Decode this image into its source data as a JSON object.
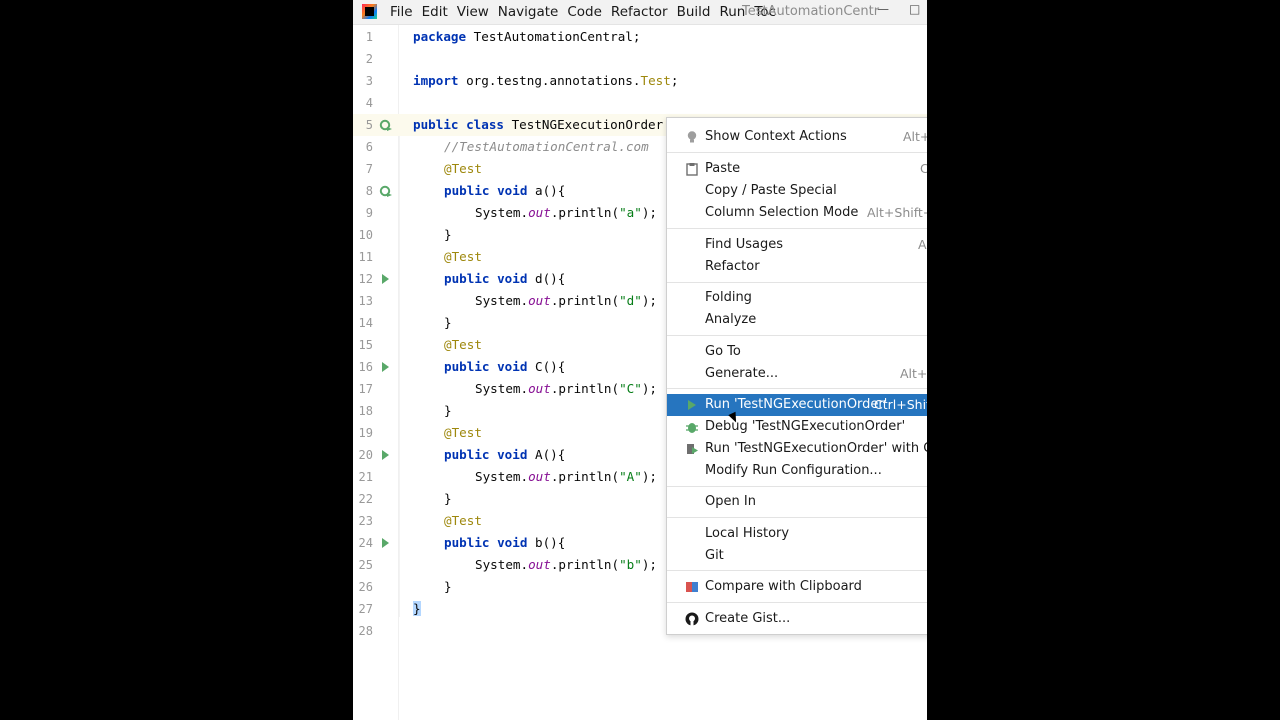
{
  "window": {
    "title": "TestAutomationCentr"
  },
  "menu": [
    "File",
    "Edit",
    "View",
    "Navigate",
    "Code",
    "Refactor",
    "Build",
    "Run",
    "Toc"
  ],
  "code_lines": [
    {
      "n": "1"
    },
    {
      "n": "2"
    },
    {
      "n": "3"
    },
    {
      "n": "4"
    },
    {
      "n": "5"
    },
    {
      "n": "6"
    },
    {
      "n": "7"
    },
    {
      "n": "8"
    },
    {
      "n": "9"
    },
    {
      "n": "10"
    },
    {
      "n": "11"
    },
    {
      "n": "12"
    },
    {
      "n": "13"
    },
    {
      "n": "14"
    },
    {
      "n": "15"
    },
    {
      "n": "16"
    },
    {
      "n": "17"
    },
    {
      "n": "18"
    },
    {
      "n": "19"
    },
    {
      "n": "20"
    },
    {
      "n": "21"
    },
    {
      "n": "22"
    },
    {
      "n": "23"
    },
    {
      "n": "24"
    },
    {
      "n": "25"
    },
    {
      "n": "26"
    },
    {
      "n": "27"
    },
    {
      "n": "28"
    }
  ],
  "code": {
    "l1": {
      "kw": "package",
      "rest": " TestAutomationCentral;"
    },
    "l3": {
      "kw": "import",
      "pre": " org.testng.annotations.",
      "ann": "Test",
      "post": ";"
    },
    "l5": {
      "kw": "public class",
      "rest": " TestNGExecutionOrder"
    },
    "l6": {
      "cmt": "//TestAutomationCentral.com"
    },
    "annotation": "@Test",
    "method_kw": "public void",
    "methods": [
      {
        "sig": " a(){",
        "body_pre": "System.",
        "field": "out",
        "body_mid": ".println(",
        "str": "\"a\"",
        "body_post": ");"
      },
      {
        "sig": " d(){",
        "body_pre": "System.",
        "field": "out",
        "body_mid": ".println(",
        "str": "\"d\"",
        "body_post": ");"
      },
      {
        "sig": " C(){",
        "body_pre": "System.",
        "field": "out",
        "body_mid": ".println(",
        "str": "\"C\"",
        "body_post": ");"
      },
      {
        "sig": " A(){",
        "body_pre": "System.",
        "field": "out",
        "body_mid": ".println(",
        "str": "\"A\"",
        "body_post": ");"
      },
      {
        "sig": " b(){",
        "body_pre": "System.",
        "field": "out",
        "body_mid": ".println(",
        "str": "\"b\"",
        "body_post": ");"
      }
    ],
    "close_brace": "}",
    "class_close": "}"
  },
  "context_menu": {
    "items": [
      {
        "label": "Show Context Actions",
        "shortcut": "Alt+"
      },
      {
        "label": "Paste",
        "shortcut": "C"
      },
      {
        "label": "Copy / Paste Special",
        "shortcut": ""
      },
      {
        "label": "Column Selection Mode",
        "shortcut": "Alt+Shift+I"
      },
      {
        "label": "Find Usages",
        "shortcut": "A"
      },
      {
        "label": "Refactor",
        "shortcut": ""
      },
      {
        "label": "Folding",
        "shortcut": ""
      },
      {
        "label": "Analyze",
        "shortcut": ""
      },
      {
        "label": "Go To",
        "shortcut": ""
      },
      {
        "label": "Generate...",
        "shortcut": "Alt+I"
      },
      {
        "label": "Run 'TestNGExecutionOrder'",
        "shortcut": "Ctrl+Shift"
      },
      {
        "label": "Debug 'TestNGExecutionOrder'",
        "shortcut": ""
      },
      {
        "label": "Run 'TestNGExecutionOrder' with Covera",
        "shortcut": ""
      },
      {
        "label": "Modify Run Configuration...",
        "shortcut": ""
      },
      {
        "label": "Open In",
        "shortcut": ""
      },
      {
        "label": "Local History",
        "shortcut": ""
      },
      {
        "label": "Git",
        "shortcut": ""
      },
      {
        "label": "Compare with Clipboard",
        "shortcut": ""
      },
      {
        "label": "Create Gist...",
        "shortcut": ""
      }
    ]
  },
  "colors": {
    "selection": "#2675bf",
    "run_green": "#59a869",
    "keyword": "#0033b3",
    "annotation": "#9e880d",
    "string": "#067d17"
  }
}
